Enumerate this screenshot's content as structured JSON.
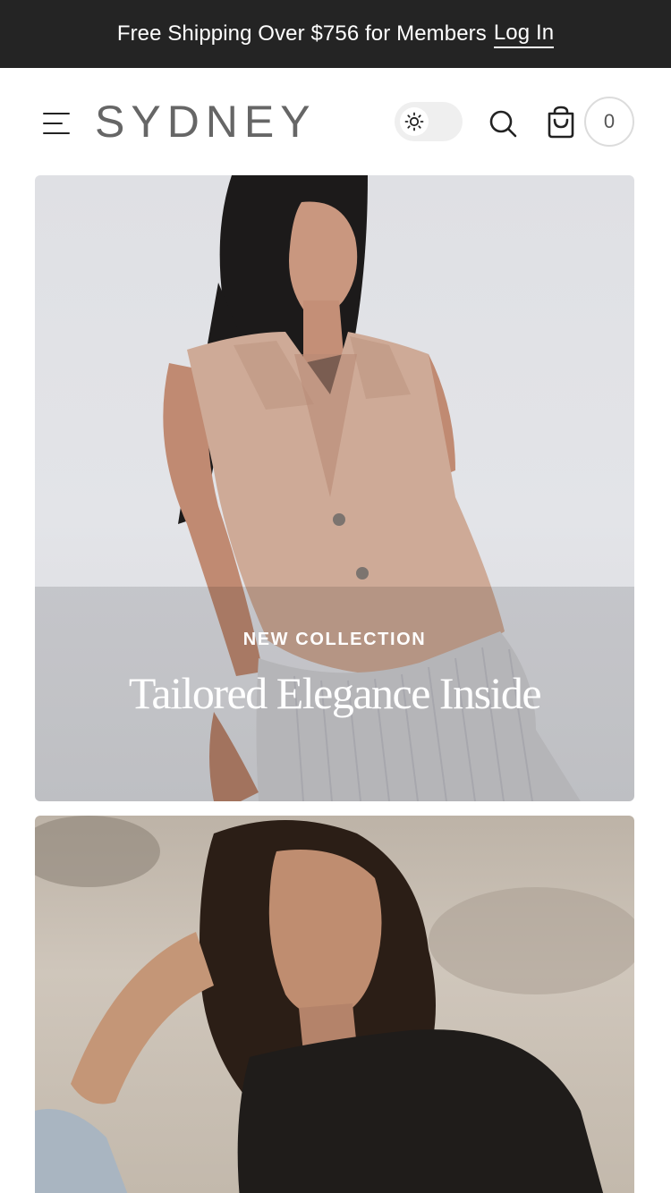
{
  "announcement": {
    "text": "Free Shipping Over $756 for Members",
    "link_label": "Log In"
  },
  "header": {
    "logo": "SYDNEY",
    "cart_count": "0",
    "icons": {
      "menu": "hamburger-menu-icon",
      "theme": "sun-icon",
      "search": "search-icon",
      "cart": "shopping-bag-icon"
    }
  },
  "hero": {
    "eyebrow": "NEW COLLECTION",
    "headline": "Tailored Elegance Inside"
  },
  "colors": {
    "announcement_bg": "#242424",
    "logo": "#666666",
    "toggle_bg": "#efefef"
  }
}
